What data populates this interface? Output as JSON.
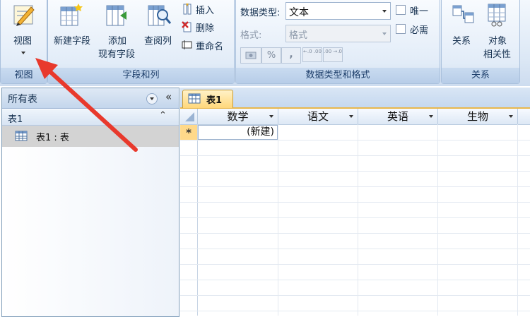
{
  "ribbon": {
    "view_group": {
      "button_label": "视图",
      "title": "视图"
    },
    "fields_group": {
      "new_field": "新建字段",
      "add_existing_line1": "添加",
      "add_existing_line2": "现有字段",
      "lookup_column": "查阅列",
      "insert": "插入",
      "delete": "删除",
      "rename": "重命名",
      "title": "字段和列"
    },
    "datatype_group": {
      "data_type_label": "数据类型:",
      "data_type_value": "文本",
      "format_label": "格式:",
      "format_value": "格式",
      "percent_symbol": "%",
      "comma_symbol": ",",
      "increase_decimals": "←.0 .00",
      "decrease_decimals": ".00 →.0",
      "unique_label": "唯一",
      "required_label": "必需",
      "title": "数据类型和格式"
    },
    "relations_group": {
      "relationships": "关系",
      "object_dep_line1": "对象",
      "object_dep_line2": "相关性",
      "title": "关系"
    }
  },
  "nav_pane": {
    "header": "所有表",
    "group_name": "表1",
    "item_label": "表1 : 表"
  },
  "document_tab": {
    "label": "表1"
  },
  "datasheet": {
    "columns": [
      "数学",
      "语文",
      "英语",
      "生物"
    ],
    "new_row_marker": "*",
    "new_row_text": "(新建)"
  },
  "colors": {
    "accent_tab": "#ffd77a",
    "ribbon_border": "#a9c0dc",
    "annotation_arrow": "#e8392c"
  }
}
